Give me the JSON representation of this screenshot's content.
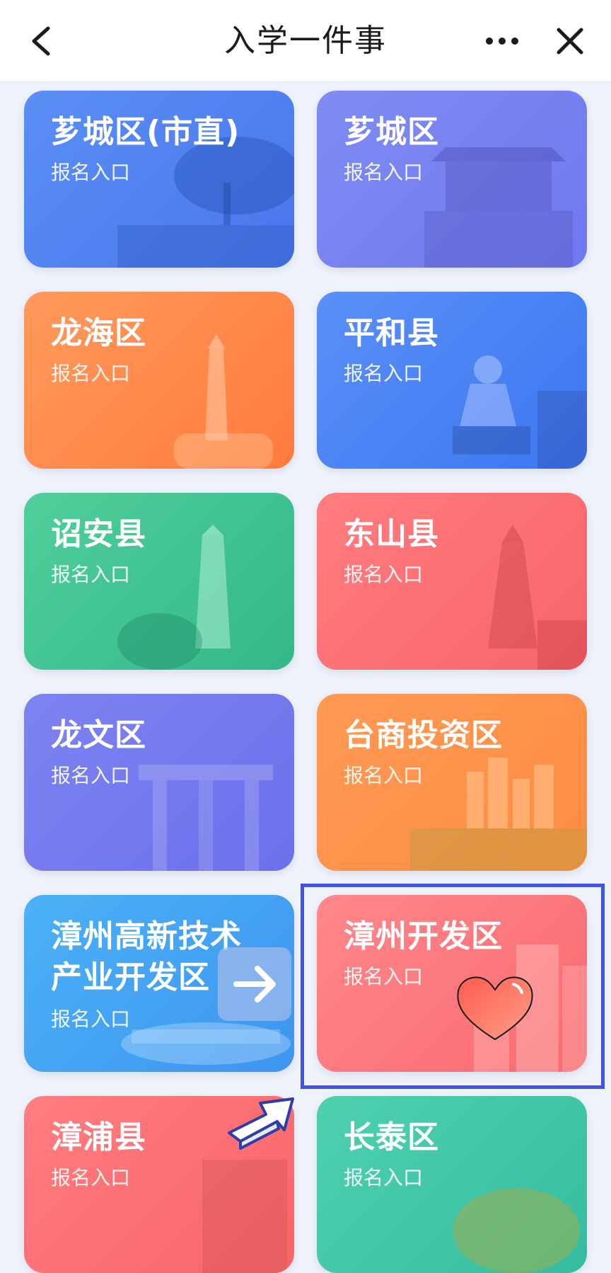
{
  "header": {
    "title": "入学一件事",
    "back_icon": "chevron-left-icon",
    "more_icon": "more-dots-icon",
    "close_icon": "close-icon"
  },
  "cards": [
    {
      "id": "xiangcheng-city",
      "name": "芗城区(市直)",
      "sub": "报名入口",
      "theme": "blue"
    },
    {
      "id": "xiangcheng",
      "name": "芗城区",
      "sub": "报名入口",
      "theme": "violet"
    },
    {
      "id": "longhai",
      "name": "龙海区",
      "sub": "报名入口",
      "theme": "orange"
    },
    {
      "id": "pinghe",
      "name": "平和县",
      "sub": "报名入口",
      "theme": "sky"
    },
    {
      "id": "zhaoan",
      "name": "诏安县",
      "sub": "报名入口",
      "theme": "green"
    },
    {
      "id": "dongshan",
      "name": "东山县",
      "sub": "报名入口",
      "theme": "coral"
    },
    {
      "id": "longwen",
      "name": "龙文区",
      "sub": "报名入口",
      "theme": "purple"
    },
    {
      "id": "taishang",
      "name": "台商投资区",
      "sub": "报名入口",
      "theme": "amber"
    },
    {
      "id": "zhangzhou-hitech",
      "name_line1": "漳州高新技术",
      "name_line2": "产业开发区",
      "sub": "报名入口",
      "theme": "azure"
    },
    {
      "id": "zhangzhou-dev",
      "name": "漳州开发区",
      "sub": "报名入口",
      "theme": "pink"
    },
    {
      "id": "zhangpu",
      "name": "漳浦县",
      "sub": "报名入口",
      "theme": "coral"
    },
    {
      "id": "changtai",
      "name": "长泰区",
      "sub": "报名入口",
      "theme": "teal"
    }
  ],
  "overlays": {
    "arrow_icon": "arrow-right-icon",
    "heart_icon": "heart-icon",
    "pointer_icon": "outline-arrow-icon",
    "highlight_color": "#3f54e0"
  }
}
